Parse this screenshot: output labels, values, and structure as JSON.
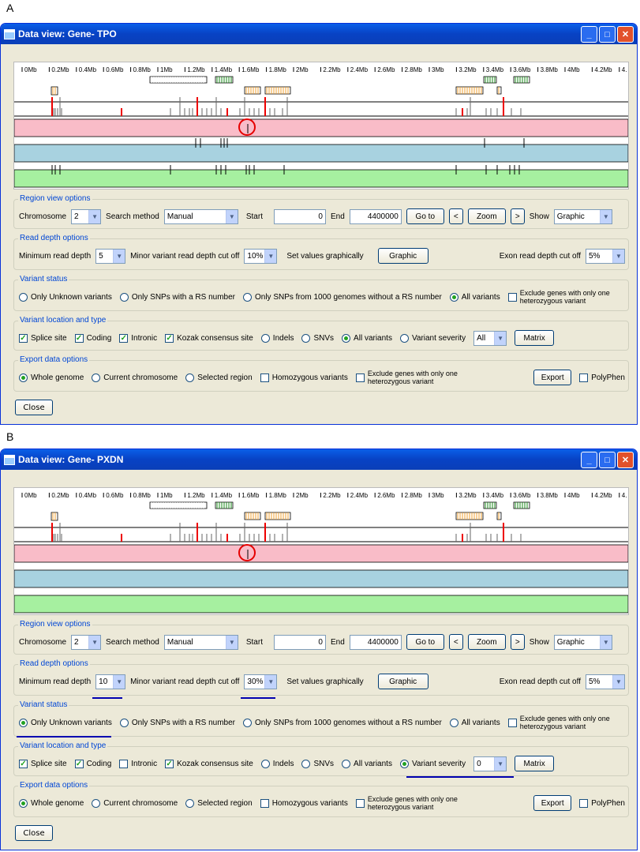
{
  "panelA": {
    "letter": "A",
    "title": "Data view: Gene- TPO",
    "ticks": [
      "0Mb",
      "0.2Mb",
      "0.4Mb",
      "0.6Mb",
      "0.8Mb",
      "1Mb",
      "1.2Mb",
      "1.4Mb",
      "1.6Mb",
      "1.8Mb",
      "2Mb",
      "2.2Mb",
      "2.4Mb",
      "2.6Mb",
      "2.8Mb",
      "3Mb",
      "3.2Mb",
      "3.4Mb",
      "3.6Mb",
      "3.8Mb",
      "4Mb",
      "4.2Mb",
      "4."
    ],
    "region": {
      "title": "Region view options",
      "chromosome_label": "Chromosome",
      "chromosome": "2",
      "method_label": "Search method",
      "method": "Manual",
      "start_label": "Start",
      "start": "0",
      "end_label": "End",
      "end": "4400000",
      "goto": "Go to",
      "prev": "<",
      "zoom": "Zoom",
      "next": ">",
      "show_label": "Show",
      "show": "Graphic"
    },
    "readdepth": {
      "title": "Read depth options",
      "min_label": "Minimum read depth",
      "min": "5",
      "minor_label": "Minor variant read depth cut off",
      "minor": "10%",
      "set_label": "Set values graphically",
      "graphic": "Graphic",
      "exon_label": "Exon read depth cut off",
      "exon": "5%"
    },
    "status": {
      "title": "Variant status",
      "opt1": "Only Unknown variants",
      "opt2": "Only SNPs with a RS number",
      "opt3": "Only SNPs from 1000 genomes without a RS number",
      "opt4": "All variants",
      "exclude1": "Exclude genes with only one",
      "exclude2": "heterozygous variant",
      "selected": 4
    },
    "location": {
      "title": "Variant location and type",
      "splice": "Splice site",
      "coding": "Coding",
      "intronic": "Intronic",
      "kozak": "Kozak consensus site",
      "indels": "Indels",
      "snvs": "SNVs",
      "all": "All variants",
      "severity": "Variant severity",
      "severity_value": "All",
      "matrix": "Matrix",
      "intronic_checked": true,
      "selected": "all"
    },
    "export": {
      "title": "Export data options",
      "whole": "Whole genome",
      "chrom": "Current chromosome",
      "region": "Selected region",
      "homo": "Homozygous variants",
      "exclude1": "Exclude genes with only one",
      "exclude2": "heterozygous variant",
      "export": "Export",
      "polyphen": "PolyPhen"
    },
    "close": "Close"
  },
  "panelB": {
    "letter": "B",
    "title": "Data view: Gene- PXDN",
    "ticks": [
      "0Mb",
      "0.2Mb",
      "0.4Mb",
      "0.6Mb",
      "0.8Mb",
      "1Mb",
      "1.2Mb",
      "1.4Mb",
      "1.6Mb",
      "1.8Mb",
      "2Mb",
      "2.2Mb",
      "2.4Mb",
      "2.6Mb",
      "2.8Mb",
      "3Mb",
      "3.2Mb",
      "3.4Mb",
      "3.6Mb",
      "3.8Mb",
      "4Mb",
      "4.2Mb",
      "4."
    ],
    "region": {
      "title": "Region view options",
      "chromosome_label": "Chromosome",
      "chromosome": "2",
      "method_label": "Search method",
      "method": "Manual",
      "start_label": "Start",
      "start": "0",
      "end_label": "End",
      "end": "4400000",
      "goto": "Go to",
      "prev": "<",
      "zoom": "Zoom",
      "next": ">",
      "show_label": "Show",
      "show": "Graphic"
    },
    "readdepth": {
      "title": "Read depth options",
      "min_label": "Minimum read depth",
      "min": "10",
      "minor_label": "Minor variant read depth cut off",
      "minor": "30%",
      "set_label": "Set values graphically",
      "graphic": "Graphic",
      "exon_label": "Exon read depth cut off",
      "exon": "5%"
    },
    "status": {
      "title": "Variant status",
      "opt1": "Only Unknown variants",
      "opt2": "Only SNPs with a RS number",
      "opt3": "Only SNPs from 1000 genomes without a RS number",
      "opt4": "All variants",
      "exclude1": "Exclude genes with only one",
      "exclude2": "heterozygous variant",
      "selected": 1
    },
    "location": {
      "title": "Variant location and type",
      "splice": "Splice site",
      "coding": "Coding",
      "intronic": "Intronic",
      "kozak": "Kozak consensus site",
      "indels": "Indels",
      "snvs": "SNVs",
      "all": "All variants",
      "severity": "Variant severity",
      "severity_value": "0",
      "matrix": "Matrix",
      "intronic_checked": false,
      "selected": "severity"
    },
    "export": {
      "title": "Export data options",
      "whole": "Whole genome",
      "chrom": "Current chromosome",
      "region": "Selected region",
      "homo": "Homozygous variants",
      "exclude1": "Exclude genes with only one",
      "exclude2": "heterozygous variant",
      "export": "Export",
      "polyphen": "PolyPhen"
    },
    "close": "Close"
  },
  "colors": {
    "pink": "#f9bcc8",
    "blue": "#a8d2e0",
    "green": "#a6f0a0",
    "highlight": "#e60000",
    "underline": "#0000b0"
  }
}
